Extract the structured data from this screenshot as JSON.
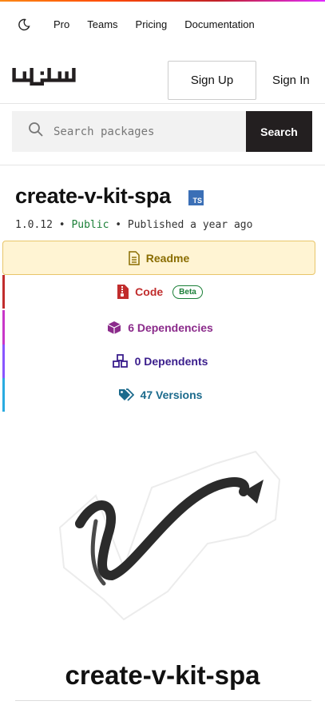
{
  "nav": {
    "theme_toggle": "moon-icon",
    "links": [
      "Pro",
      "Teams",
      "Pricing",
      "Documentation"
    ]
  },
  "header": {
    "logo": "npm",
    "sign_up": "Sign Up",
    "sign_in": "Sign In"
  },
  "search": {
    "placeholder": "Search packages",
    "button": "Search"
  },
  "package": {
    "name": "create-v-kit-spa",
    "ts_badge": "TS",
    "version": "1.0.12",
    "visibility": "Public",
    "published": "Published a year ago"
  },
  "tabs": {
    "readme": "Readme",
    "code": "Code",
    "beta": "Beta",
    "dependencies": "6 Dependencies",
    "dependents": "0 Dependents",
    "versions": "47 Versions"
  },
  "readme": {
    "title": "create-v-kit-spa"
  },
  "colors": {
    "readme_bg": "#fff4d3",
    "code": "#c12d2d",
    "dependencies": "#8b2b8b",
    "dependents": "#3a1d8c",
    "versions": "#1b6a8c",
    "public": "#1a7f37",
    "search_button": "#231f20"
  }
}
